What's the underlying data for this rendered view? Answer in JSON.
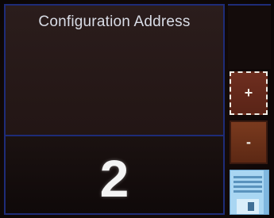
{
  "screen": {
    "title": "Configuration Address",
    "value": "2"
  },
  "buttons": {
    "increment_label": "+",
    "decrement_label": "-",
    "save_icon": "floppy-disk-icon"
  },
  "colors": {
    "panel_border": "#1e2c78",
    "button_orange": "#6e2e1f",
    "save_blue": "#9fd0f0"
  }
}
